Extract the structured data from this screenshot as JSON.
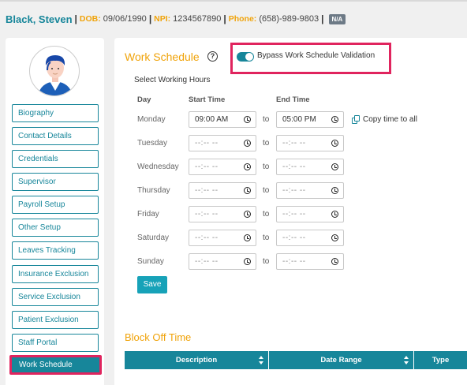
{
  "header": {
    "name": "Black, Steven",
    "dob_label": "DOB:",
    "dob": "09/06/1990",
    "npi_label": "NPI:",
    "npi": "1234567890",
    "phone_label": "Phone:",
    "phone": "(658)-989-9803",
    "badge": "N/A"
  },
  "sidebar": {
    "items": [
      {
        "label": "Biography"
      },
      {
        "label": "Contact Details"
      },
      {
        "label": "Credentials"
      },
      {
        "label": "Supervisor"
      },
      {
        "label": "Payroll Setup"
      },
      {
        "label": "Other Setup"
      },
      {
        "label": "Leaves Tracking"
      },
      {
        "label": "Insurance Exclusion"
      },
      {
        "label": "Service Exclusion"
      },
      {
        "label": "Patient Exclusion"
      },
      {
        "label": "Staff Portal"
      },
      {
        "label": "Work Schedule",
        "active": true
      }
    ]
  },
  "work_schedule": {
    "title": "Work Schedule",
    "help_icon": "?",
    "bypass_label": "Bypass Work Schedule Validation",
    "bypass_enabled": true,
    "select_hours_label": "Select Working Hours",
    "col_day": "Day",
    "col_start": "Start Time",
    "col_end": "End Time",
    "to_label": "to",
    "copy_label": "Copy time to all",
    "days": [
      {
        "day": "Monday",
        "start": "09:00 AM",
        "end": "05:00 PM"
      },
      {
        "day": "Tuesday",
        "start": "--:-- --",
        "end": "--:-- --"
      },
      {
        "day": "Wednesday",
        "start": "--:-- --",
        "end": "--:-- --"
      },
      {
        "day": "Thursday",
        "start": "--:-- --",
        "end": "--:-- --"
      },
      {
        "day": "Friday",
        "start": "--:-- --",
        "end": "--:-- --"
      },
      {
        "day": "Saturday",
        "start": "--:-- --",
        "end": "--:-- --"
      },
      {
        "day": "Sunday",
        "start": "--:-- --",
        "end": "--:-- --"
      }
    ],
    "save_label": "Save"
  },
  "block_off": {
    "title": "Block Off Time",
    "columns": [
      "Description",
      "Date Range",
      "Type"
    ]
  },
  "colors": {
    "primary_teal": "#17869a",
    "accent_orange": "#f0a30a",
    "highlight_pink": "#e0245e",
    "save_button": "#17a2b8"
  },
  "icons": [
    "user-avatar-icon",
    "help-circle-icon",
    "toggle-switch-icon",
    "clock-icon",
    "copy-icon",
    "sort-icon"
  ]
}
